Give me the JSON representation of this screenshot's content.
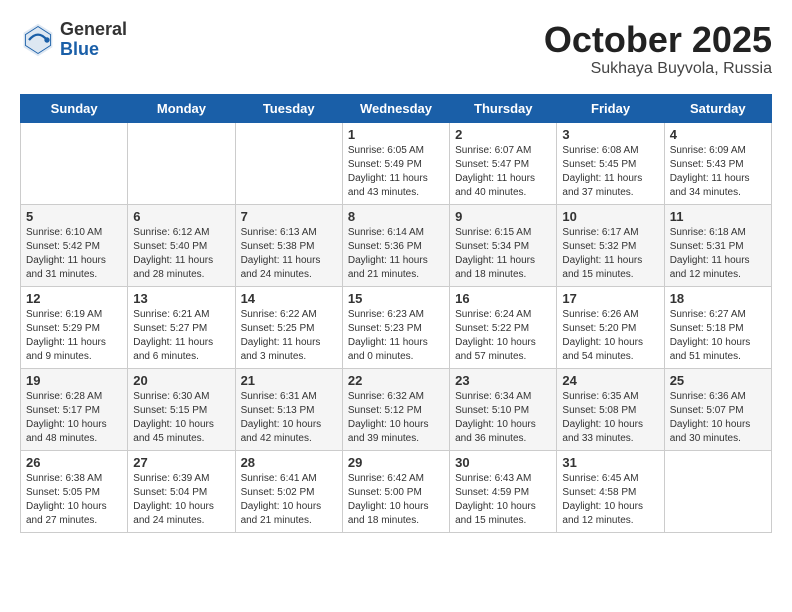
{
  "logo": {
    "general": "General",
    "blue": "Blue"
  },
  "title": {
    "month": "October 2025",
    "location": "Sukhaya Buyvola, Russia"
  },
  "weekdays": [
    "Sunday",
    "Monday",
    "Tuesday",
    "Wednesday",
    "Thursday",
    "Friday",
    "Saturday"
  ],
  "weeks": [
    [
      {
        "day": "",
        "sunrise": "",
        "sunset": "",
        "daylight": ""
      },
      {
        "day": "",
        "sunrise": "",
        "sunset": "",
        "daylight": ""
      },
      {
        "day": "",
        "sunrise": "",
        "sunset": "",
        "daylight": ""
      },
      {
        "day": "1",
        "sunrise": "Sunrise: 6:05 AM",
        "sunset": "Sunset: 5:49 PM",
        "daylight": "Daylight: 11 hours and 43 minutes."
      },
      {
        "day": "2",
        "sunrise": "Sunrise: 6:07 AM",
        "sunset": "Sunset: 5:47 PM",
        "daylight": "Daylight: 11 hours and 40 minutes."
      },
      {
        "day": "3",
        "sunrise": "Sunrise: 6:08 AM",
        "sunset": "Sunset: 5:45 PM",
        "daylight": "Daylight: 11 hours and 37 minutes."
      },
      {
        "day": "4",
        "sunrise": "Sunrise: 6:09 AM",
        "sunset": "Sunset: 5:43 PM",
        "daylight": "Daylight: 11 hours and 34 minutes."
      }
    ],
    [
      {
        "day": "5",
        "sunrise": "Sunrise: 6:10 AM",
        "sunset": "Sunset: 5:42 PM",
        "daylight": "Daylight: 11 hours and 31 minutes."
      },
      {
        "day": "6",
        "sunrise": "Sunrise: 6:12 AM",
        "sunset": "Sunset: 5:40 PM",
        "daylight": "Daylight: 11 hours and 28 minutes."
      },
      {
        "day": "7",
        "sunrise": "Sunrise: 6:13 AM",
        "sunset": "Sunset: 5:38 PM",
        "daylight": "Daylight: 11 hours and 24 minutes."
      },
      {
        "day": "8",
        "sunrise": "Sunrise: 6:14 AM",
        "sunset": "Sunset: 5:36 PM",
        "daylight": "Daylight: 11 hours and 21 minutes."
      },
      {
        "day": "9",
        "sunrise": "Sunrise: 6:15 AM",
        "sunset": "Sunset: 5:34 PM",
        "daylight": "Daylight: 11 hours and 18 minutes."
      },
      {
        "day": "10",
        "sunrise": "Sunrise: 6:17 AM",
        "sunset": "Sunset: 5:32 PM",
        "daylight": "Daylight: 11 hours and 15 minutes."
      },
      {
        "day": "11",
        "sunrise": "Sunrise: 6:18 AM",
        "sunset": "Sunset: 5:31 PM",
        "daylight": "Daylight: 11 hours and 12 minutes."
      }
    ],
    [
      {
        "day": "12",
        "sunrise": "Sunrise: 6:19 AM",
        "sunset": "Sunset: 5:29 PM",
        "daylight": "Daylight: 11 hours and 9 minutes."
      },
      {
        "day": "13",
        "sunrise": "Sunrise: 6:21 AM",
        "sunset": "Sunset: 5:27 PM",
        "daylight": "Daylight: 11 hours and 6 minutes."
      },
      {
        "day": "14",
        "sunrise": "Sunrise: 6:22 AM",
        "sunset": "Sunset: 5:25 PM",
        "daylight": "Daylight: 11 hours and 3 minutes."
      },
      {
        "day": "15",
        "sunrise": "Sunrise: 6:23 AM",
        "sunset": "Sunset: 5:23 PM",
        "daylight": "Daylight: 11 hours and 0 minutes."
      },
      {
        "day": "16",
        "sunrise": "Sunrise: 6:24 AM",
        "sunset": "Sunset: 5:22 PM",
        "daylight": "Daylight: 10 hours and 57 minutes."
      },
      {
        "day": "17",
        "sunrise": "Sunrise: 6:26 AM",
        "sunset": "Sunset: 5:20 PM",
        "daylight": "Daylight: 10 hours and 54 minutes."
      },
      {
        "day": "18",
        "sunrise": "Sunrise: 6:27 AM",
        "sunset": "Sunset: 5:18 PM",
        "daylight": "Daylight: 10 hours and 51 minutes."
      }
    ],
    [
      {
        "day": "19",
        "sunrise": "Sunrise: 6:28 AM",
        "sunset": "Sunset: 5:17 PM",
        "daylight": "Daylight: 10 hours and 48 minutes."
      },
      {
        "day": "20",
        "sunrise": "Sunrise: 6:30 AM",
        "sunset": "Sunset: 5:15 PM",
        "daylight": "Daylight: 10 hours and 45 minutes."
      },
      {
        "day": "21",
        "sunrise": "Sunrise: 6:31 AM",
        "sunset": "Sunset: 5:13 PM",
        "daylight": "Daylight: 10 hours and 42 minutes."
      },
      {
        "day": "22",
        "sunrise": "Sunrise: 6:32 AM",
        "sunset": "Sunset: 5:12 PM",
        "daylight": "Daylight: 10 hours and 39 minutes."
      },
      {
        "day": "23",
        "sunrise": "Sunrise: 6:34 AM",
        "sunset": "Sunset: 5:10 PM",
        "daylight": "Daylight: 10 hours and 36 minutes."
      },
      {
        "day": "24",
        "sunrise": "Sunrise: 6:35 AM",
        "sunset": "Sunset: 5:08 PM",
        "daylight": "Daylight: 10 hours and 33 minutes."
      },
      {
        "day": "25",
        "sunrise": "Sunrise: 6:36 AM",
        "sunset": "Sunset: 5:07 PM",
        "daylight": "Daylight: 10 hours and 30 minutes."
      }
    ],
    [
      {
        "day": "26",
        "sunrise": "Sunrise: 6:38 AM",
        "sunset": "Sunset: 5:05 PM",
        "daylight": "Daylight: 10 hours and 27 minutes."
      },
      {
        "day": "27",
        "sunrise": "Sunrise: 6:39 AM",
        "sunset": "Sunset: 5:04 PM",
        "daylight": "Daylight: 10 hours and 24 minutes."
      },
      {
        "day": "28",
        "sunrise": "Sunrise: 6:41 AM",
        "sunset": "Sunset: 5:02 PM",
        "daylight": "Daylight: 10 hours and 21 minutes."
      },
      {
        "day": "29",
        "sunrise": "Sunrise: 6:42 AM",
        "sunset": "Sunset: 5:00 PM",
        "daylight": "Daylight: 10 hours and 18 minutes."
      },
      {
        "day": "30",
        "sunrise": "Sunrise: 6:43 AM",
        "sunset": "Sunset: 4:59 PM",
        "daylight": "Daylight: 10 hours and 15 minutes."
      },
      {
        "day": "31",
        "sunrise": "Sunrise: 6:45 AM",
        "sunset": "Sunset: 4:58 PM",
        "daylight": "Daylight: 10 hours and 12 minutes."
      },
      {
        "day": "",
        "sunrise": "",
        "sunset": "",
        "daylight": ""
      }
    ]
  ]
}
